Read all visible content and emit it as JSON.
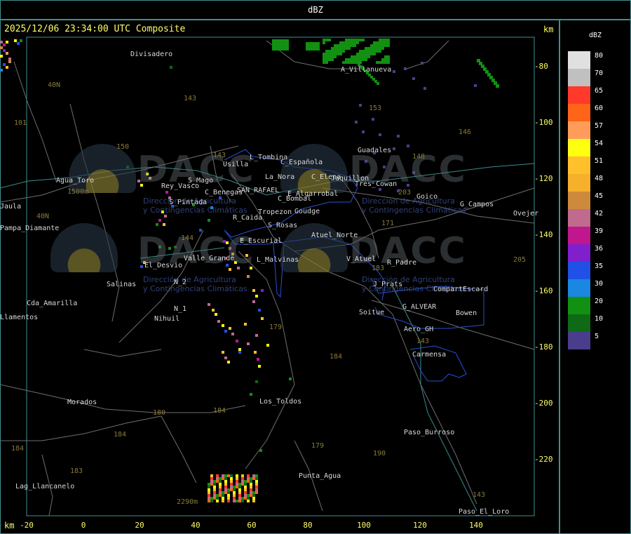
{
  "header": {
    "title": "dBZ"
  },
  "map": {
    "title": "2025/12/06 23:34:00 UTC Composite",
    "unit_top": "km",
    "unit_bottom": "km",
    "x_ticks": [
      "-20",
      "0",
      "20",
      "40",
      "60",
      "80",
      "100",
      "120",
      "140"
    ],
    "y_ticks": [
      "-80",
      "-100",
      "-120",
      "-140",
      "-160",
      "-180",
      "-200",
      "-220"
    ],
    "places": [
      "Divisadero",
      "A_Villanueva",
      "Guadales",
      "Agua_Toro",
      "Pampa_Diamante",
      "Usilla",
      "L_Tombina",
      "C_Española",
      "La_Nora",
      "C_Elena",
      "Jaquillon",
      "C_Bombal",
      "Tres_Cowan",
      "C_Benegas",
      "SAN_RAFAEL",
      "E_Algarrobal",
      "Goico",
      "G_Campos",
      "Ovejer",
      "Rey_Vasco",
      "S_Pintada",
      "S_Mago",
      "R_Caida",
      "Tropezon",
      "Goudge",
      "S_Rosas",
      "Atuel_Norte",
      "E_Escurial",
      "Valle_Grande",
      "L_Malvinas",
      "V_Atuel",
      "R_Padre",
      "El_Desvio",
      "Salinas",
      "N_2",
      "N_1",
      "Nihuil",
      "Cda_Amarilla",
      "Llamentos",
      "Jaula",
      "J_Prats",
      "CompartEscard",
      "G_ALVEAR",
      "Soitue",
      "Bowen",
      "Aero_GH",
      "Carmensa",
      "Morados",
      "Los_Toldos",
      "Paso_Burroso",
      "Lag_Llancanelo",
      "Punta_Agua",
      "Paso_El_Loro"
    ],
    "route_numbers": [
      "143",
      "40N",
      "101",
      "150",
      "143",
      "153",
      "146",
      "148",
      "203",
      "171",
      "144",
      "183",
      "179",
      "184",
      "180",
      "184",
      "179",
      "190",
      "184",
      "183",
      "143",
      "205",
      "40N"
    ],
    "elevations": [
      "1500m",
      "2290m"
    ],
    "watermark": {
      "logo_text": "DACC",
      "subtitle_line1": "Dirección de Agricultura",
      "subtitle_line2": "y Contingencias Climáticas"
    }
  },
  "legend": {
    "title": "dBZ",
    "items": [
      {
        "value": "80",
        "color": "#e0e0e0"
      },
      {
        "value": "70",
        "color": "#c0c0c0"
      },
      {
        "value": "65",
        "color": "#ff3a2a"
      },
      {
        "value": "60",
        "color": "#ff6418"
      },
      {
        "value": "57",
        "color": "#ff9c5a"
      },
      {
        "value": "54",
        "color": "#ffff10"
      },
      {
        "value": "51",
        "color": "#ffc02c"
      },
      {
        "value": "48",
        "color": "#f7b02c"
      },
      {
        "value": "45",
        "color": "#cd8a3c"
      },
      {
        "value": "42",
        "color": "#c06a8e"
      },
      {
        "value": "39",
        "color": "#c0168e"
      },
      {
        "value": "36",
        "color": "#8020cc"
      },
      {
        "value": "35",
        "color": "#2050e6"
      },
      {
        "value": "30",
        "color": "#1a88e0"
      },
      {
        "value": "20",
        "color": "#129012"
      },
      {
        "value": "10",
        "color": "#0e6a14"
      },
      {
        "value": "5",
        "color": "#4a3e8c"
      }
    ]
  }
}
